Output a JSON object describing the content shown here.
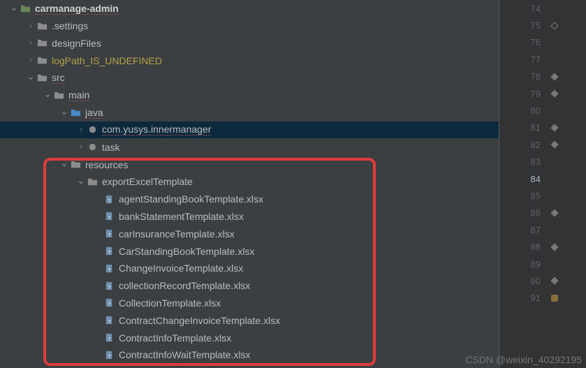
{
  "tree": [
    {
      "depth": 0,
      "arrow": "down",
      "icon": "folder-module",
      "label": "carmanage-admin",
      "bold": true,
      "underline": true
    },
    {
      "depth": 1,
      "arrow": "right",
      "icon": "folder",
      "label": ".settings"
    },
    {
      "depth": 1,
      "arrow": "right",
      "icon": "folder",
      "label": "designFiles"
    },
    {
      "depth": 1,
      "arrow": "right",
      "icon": "folder",
      "label": "logPath_IS_UNDEFINED",
      "warn": true
    },
    {
      "depth": 1,
      "arrow": "down",
      "icon": "folder",
      "label": "src",
      "underline": true
    },
    {
      "depth": 2,
      "arrow": "down",
      "icon": "folder",
      "label": "main",
      "underline": true
    },
    {
      "depth": 3,
      "arrow": "down",
      "icon": "folder-src",
      "label": "java",
      "underline": true
    },
    {
      "depth": 4,
      "arrow": "right",
      "icon": "package",
      "label": "com.yusys.innermanager",
      "selected": true,
      "underline": true
    },
    {
      "depth": 4,
      "arrow": "right",
      "icon": "package",
      "label": "task"
    },
    {
      "depth": 3,
      "arrow": "down",
      "icon": "folder-res",
      "label": "resources"
    },
    {
      "depth": 4,
      "arrow": "down",
      "icon": "folder",
      "label": "exportExcelTemplate"
    },
    {
      "depth": 5,
      "arrow": "none",
      "icon": "file",
      "label": "agentStandingBookTemplate.xlsx"
    },
    {
      "depth": 5,
      "arrow": "none",
      "icon": "file",
      "label": "bankStatementTemplate.xlsx"
    },
    {
      "depth": 5,
      "arrow": "none",
      "icon": "file",
      "label": "carInsuranceTemplate.xlsx"
    },
    {
      "depth": 5,
      "arrow": "none",
      "icon": "file",
      "label": "CarStandingBookTemplate.xlsx"
    },
    {
      "depth": 5,
      "arrow": "none",
      "icon": "file",
      "label": "ChangeInvoiceTemplate.xlsx"
    },
    {
      "depth": 5,
      "arrow": "none",
      "icon": "file",
      "label": "collectionRecordTemplate.xlsx"
    },
    {
      "depth": 5,
      "arrow": "none",
      "icon": "file",
      "label": "CollectionTemplate.xlsx"
    },
    {
      "depth": 5,
      "arrow": "none",
      "icon": "file",
      "label": "ContractChangeInvoiceTemplate.xlsx"
    },
    {
      "depth": 5,
      "arrow": "none",
      "icon": "file",
      "label": "ContractInfoTemplate.xlsx"
    },
    {
      "depth": 5,
      "arrow": "none",
      "icon": "file",
      "label": "ContractInfoWaitTemplate.xlsx"
    }
  ],
  "gutter": [
    {
      "num": 74,
      "mark": ""
    },
    {
      "num": 75,
      "mark": "diamond"
    },
    {
      "num": 76,
      "mark": ""
    },
    {
      "num": 77,
      "mark": ""
    },
    {
      "num": 78,
      "mark": "diamond-solid"
    },
    {
      "num": 79,
      "mark": "diamond-solid"
    },
    {
      "num": 80,
      "mark": ""
    },
    {
      "num": 81,
      "mark": "diamond-solid"
    },
    {
      "num": 82,
      "mark": "diamond-solid"
    },
    {
      "num": 83,
      "mark": ""
    },
    {
      "num": 84,
      "mark": "",
      "active": true
    },
    {
      "num": 85,
      "mark": ""
    },
    {
      "num": 86,
      "mark": "diamond-solid"
    },
    {
      "num": 87,
      "mark": ""
    },
    {
      "num": 88,
      "mark": "diamond-solid"
    },
    {
      "num": 89,
      "mark": ""
    },
    {
      "num": 90,
      "mark": "diamond-solid"
    },
    {
      "num": 91,
      "mark": "warn"
    }
  ],
  "watermark": "CSDN @weixin_40292195"
}
